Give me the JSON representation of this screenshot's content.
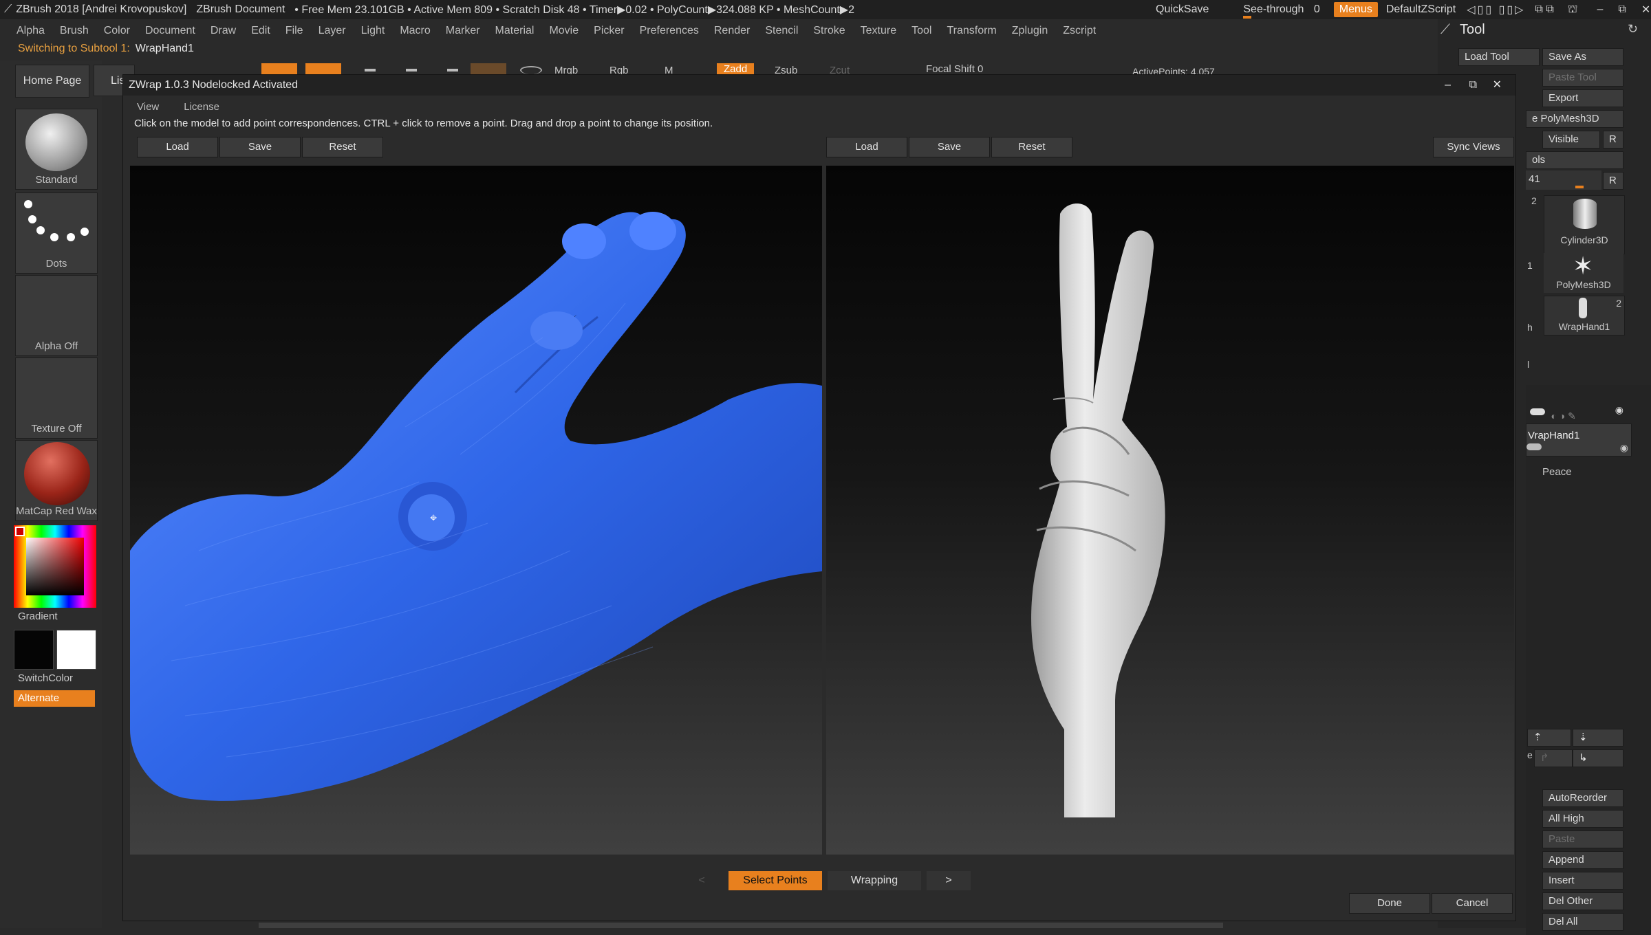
{
  "app": {
    "title": "ZBrush 2018 [Andrei Krovopuskov]",
    "document": "ZBrush Document",
    "stats": "• Free Mem 23.101GB • Active Mem 809 • Scratch Disk 48 • Timer▶0.02 • PolyCount▶324.088 KP • MeshCount▶2",
    "quicksave": "QuickSave",
    "seethrough": "See-through",
    "seethrough_value": "0",
    "menus": "Menus",
    "script": "DefaultZScript"
  },
  "menubar": [
    "Alpha",
    "Brush",
    "Color",
    "Document",
    "Draw",
    "Edit",
    "File",
    "Layer",
    "Light",
    "Macro",
    "Marker",
    "Material",
    "Movie",
    "Picker",
    "Preferences",
    "Render",
    "Stencil",
    "Stroke",
    "Texture",
    "Tool",
    "Transform",
    "Zplugin",
    "Zscript"
  ],
  "subtool_note": {
    "label": "Switching to Subtool 1:",
    "value": "WrapHand1"
  },
  "top_toolbar": {
    "mrgb": "Mrgb",
    "rgb": "Rgb",
    "m": "M",
    "zadd": "Zadd",
    "zsub": "Zsub",
    "zcut": "Zcut",
    "focal_shift": "Focal Shift 0",
    "active_points": "ActivePoints: 4,057"
  },
  "left": {
    "home": "Home Page",
    "lis": "Lis",
    "brush": "Standard",
    "stroke": "Dots",
    "alpha": "Alpha Off",
    "texture": "Texture Off",
    "material": "MatCap Red Wax",
    "gradient": "Gradient",
    "switchcolor": "SwitchColor",
    "alternate": "Alternate"
  },
  "tool_panel": {
    "title": "Tool",
    "load_tool": "Load Tool",
    "save_as": "Save As",
    "paste_tool": "Paste Tool",
    "export": "Export",
    "polymesh3d_btn": "e PolyMesh3D",
    "visible": "Visible",
    "r": "R",
    "ols": "ols",
    "slider_value": "41",
    "num2": "2",
    "num1": "1",
    "h": "h",
    "l": "l",
    "cylinder": "Cylinder3D",
    "polymesh": "PolyMesh3D",
    "wraphand": "WrapHand1",
    "wraphand_count": "2",
    "subtool_name": "VrapHand1",
    "peace": "Peace",
    "e": "e",
    "autoreorder": "AutoReorder",
    "allhigh": "All High",
    "paste": "Paste",
    "append": "Append",
    "insert": "Insert",
    "delother": "Del Other",
    "delall": "Del All"
  },
  "dialog": {
    "title": "ZWrap 1.0.3  Nodelocked Activated",
    "menu": [
      "View",
      "License"
    ],
    "instructions": "Click on the model to add point correspondences. CTRL + click to remove a point. Drag and drop a point to change its position.",
    "left_buttons": [
      "Load",
      "Save",
      "Reset"
    ],
    "right_buttons": [
      "Load",
      "Save",
      "Reset"
    ],
    "sync_views": "Sync Views",
    "step_prev": "<",
    "step_select": "Select Points",
    "step_wrapping": "Wrapping",
    "step_next": ">",
    "done": "Done",
    "cancel": "Cancel"
  },
  "colors": {
    "accent": "#e8801e",
    "basemesh": "#2f66e8",
    "scan": "#e4e4e4"
  }
}
